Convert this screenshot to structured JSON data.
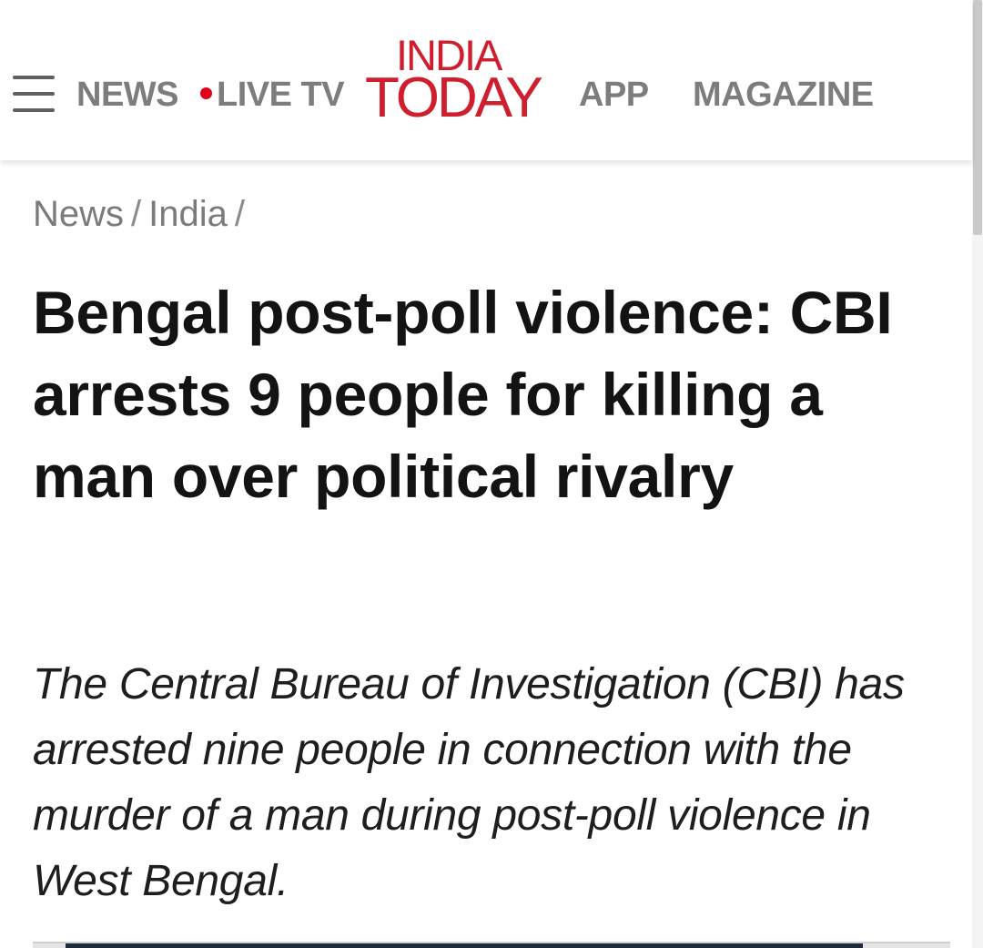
{
  "header": {
    "nav": {
      "news": "NEWS",
      "live_tv": "LIVE TV",
      "app": "APP",
      "magazine": "MAGAZINE"
    },
    "logo": {
      "top": "INDIA",
      "bottom": "TODAY"
    },
    "menu_icon": "hamburger-menu-icon",
    "live_indicator_color": "#e0001b",
    "brand_color": "#cf1f2e"
  },
  "breadcrumb": {
    "items": [
      "News",
      "India"
    ],
    "separator": "/"
  },
  "article": {
    "headline": "Bengal post-poll violence: CBI arrests 9 people for killing a man over political rivalry",
    "summary": "The Central Bureau of Investigation (CBI) has arrested nine people in connection with the murder of a man during post-poll violence in West Bengal."
  }
}
